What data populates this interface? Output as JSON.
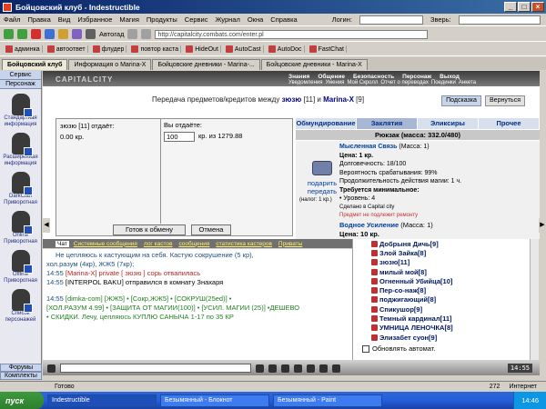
{
  "window": {
    "title": "Бойцовский клуб - Indestructible",
    "min": "_",
    "max": "□",
    "close": "×"
  },
  "menu": {
    "items": [
      "Файл",
      "Правка",
      "Вид",
      "Избранное",
      "Магия",
      "Продукты",
      "Сервис",
      "Журнал",
      "Окна",
      "Справка"
    ],
    "login_label": "Логин:",
    "beast_label": "Зверь:"
  },
  "toolbar": {
    "autogad_label": "Автогад",
    "address": "http://capitalcity.combats.com/enter.pl"
  },
  "bookmarks": [
    "админка",
    "автоответ",
    "флудер",
    "повтор каста",
    "HideOut",
    "AutoCast",
    "AutoDoc",
    "FastChat"
  ],
  "tabs": [
    "Бойцовский клуб",
    "Информация о Marina-X",
    "Бойцовские дневники - Marina-...",
    "Бойцовские дневники - Marina-X"
  ],
  "sidebar": {
    "service": "Сервис",
    "characters": "Персонаж",
    "items": [
      "Стандартная информация",
      "Расширенная информация",
      "DarkClan Приворотная",
      "Online Приворотная",
      "Offline Приворотная",
      "Список персонажей"
    ],
    "forums": "Форумы",
    "complects": "Комплекты"
  },
  "game": {
    "logo": "CAPITALCITY",
    "nav_top": [
      "Знания",
      "Общение",
      "Безопасность",
      "Персонаж",
      "Выход"
    ],
    "nav_bottom": [
      "Уведомления",
      "Умения",
      "Мой Скролл",
      "Отчет о переводах",
      "Поединки",
      "Анкета"
    ],
    "transfer_text": "Передача предметов/кредитов между",
    "user1": "зюзю",
    "user1_level": "[11]",
    "and_word": "и",
    "user2": "Marina-X",
    "user2_level": "[9]",
    "hint_button": "Подсказка",
    "back_button": "Вернуться",
    "user_gives_header": "зюзю [11] отдаёт:",
    "user_credits": "0.00 кр.",
    "you_give_label": "Вы отдаёте:",
    "give_amount": "100",
    "give_of": "кр. из 1279.88",
    "ready_button": "Готов к обмену",
    "cancel_button": "Отмена"
  },
  "inventory": {
    "tabs": [
      "Обмундирование",
      "Заклятия",
      "Эликсиры",
      "Прочее"
    ],
    "active_tab": "Заклятия",
    "backpack": "Рюкзак (масса: 332.0/480)",
    "item_action": "подарить передать",
    "item_note": "(налог: 1 кр.)",
    "item": {
      "name": "Мысленная Связь",
      "mass": "(Масса: 1)",
      "price": "Цена: 1 кр.",
      "durability": "Долговечность: 18/100",
      "chance": "Вероятность срабатывания: 99%",
      "duration": "Продолжительность действия магии: 1 ч.",
      "req_title": "Требуется минимальное:",
      "req_level": "• Уровень: 4",
      "made_in": "Сделано в Capital city",
      "no_repair": "Предмет не подлежит ремонту"
    },
    "item2": {
      "name": "Водное Усиление",
      "mass": "(Масса: 1)",
      "price": "Цена: 10 кр."
    }
  },
  "chat": {
    "tabs": [
      "Чат",
      "Системные сообщения",
      "лог кастов",
      "сообщения",
      "статистика кастеров",
      "Приваты"
    ],
    "lines": [
      {
        "time": "",
        "text": "Не цепляюсь к кастующим на себя.    Кастую сокрушение (5 кр),",
        "cls": "t"
      },
      {
        "time": "",
        "text": "хол.разум (4кр), ЖЖ5 (7кр);",
        "cls": "t"
      },
      {
        "time": "14:55",
        "text": "[Marina-X] private [ зюзю ] сорь отвалилась",
        "cls": "r"
      },
      {
        "time": "14:55",
        "text": "[INTERPOL BAKU] отправился в комнату Знахаря",
        "cls": "k"
      },
      {
        "time": "",
        "text": "",
        "cls": "t"
      },
      {
        "time": "14:55",
        "text": "[dimka-com]   [ЖЖ5] • [Сокр,ЖЖ5] • [СОКРУШ(25ed)] •",
        "cls": "g"
      },
      {
        "time": "",
        "text": "[ХОЛ.РАЗУМ 4.99] • [ЗАЩИТА ОТ МАГИИ(100)] • [УСИЛ. МАГИИ (25)] •ДЕШЕВО",
        "cls": "g"
      },
      {
        "time": "",
        "text": "• СКИДКИ. Лечу, цепляюсь  КУПЛЮ САНЫЧА 1-17 по 35 КР",
        "cls": "g"
      }
    ]
  },
  "users": {
    "list": [
      "Добрыня Дичь[9]",
      "Злой Зайка[8]",
      "зюзю[11]",
      "милый мой[8]",
      "Огненный Убийца[10]",
      "Пер-со-наж[8]",
      "поджигающий[8]",
      "Спикушор[9]",
      "Темный кардинал[11]",
      "УМНИЦА ЛЕНОЧКА[8]",
      "Элизабет суон[9]"
    ],
    "auto_update": "Обновлять автомат."
  },
  "clock": "14:55",
  "status": {
    "left": "Готово",
    "zoom": "272",
    "zone": "Интернет"
  },
  "taskbar": {
    "start": "пуск",
    "tasks": [
      "Indestructible",
      "Безымянный - Блокнот",
      "Безымянный - Paint"
    ],
    "time": "14:46"
  }
}
